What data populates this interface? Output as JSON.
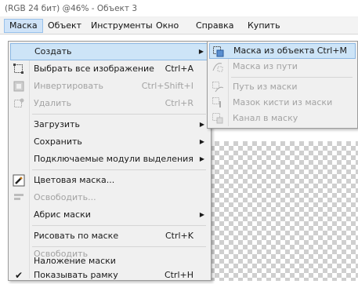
{
  "window": {
    "title": "(RGB 24 бит) @46% - Объект 3"
  },
  "menubar": {
    "items": [
      {
        "label": "Маска"
      },
      {
        "label": "Объект"
      },
      {
        "label": "Инструменты"
      },
      {
        "label": "Окно"
      },
      {
        "label": "Справка"
      },
      {
        "label": "Купить"
      }
    ]
  },
  "mask_menu": {
    "items": [
      {
        "label": "Создать",
        "shortcut": "",
        "submenu": true,
        "disabled": false,
        "icon": ""
      },
      {
        "label": "Выбрать все изображение",
        "shortcut": "Ctrl+A",
        "submenu": false,
        "disabled": false,
        "icon": "select-all-icon"
      },
      {
        "label": "Инвертировать",
        "shortcut": "Ctrl+Shift+I",
        "submenu": false,
        "disabled": true,
        "icon": "invert-mask-icon"
      },
      {
        "label": "Удалить",
        "shortcut": "Ctrl+R",
        "submenu": false,
        "disabled": true,
        "icon": "remove-mask-icon"
      },
      {
        "label": "Загрузить",
        "shortcut": "",
        "submenu": true,
        "disabled": false,
        "icon": ""
      },
      {
        "label": "Сохранить",
        "shortcut": "",
        "submenu": true,
        "disabled": false,
        "icon": ""
      },
      {
        "label": "Подключаемые модули выделения",
        "shortcut": "",
        "submenu": true,
        "disabled": false,
        "icon": ""
      },
      {
        "label": "Цветовая маска...",
        "shortcut": "",
        "submenu": false,
        "disabled": false,
        "icon": "color-mask-icon"
      },
      {
        "label": "Освободить...",
        "shortcut": "",
        "submenu": false,
        "disabled": true,
        "icon": "float-icon"
      },
      {
        "label": "Абрис маски",
        "shortcut": "",
        "submenu": true,
        "disabled": false,
        "icon": ""
      },
      {
        "label": "Рисовать по маске",
        "shortcut": "Ctrl+K",
        "submenu": false,
        "disabled": false,
        "icon": ""
      },
      {
        "label": "Освободить",
        "shortcut": "",
        "submenu": false,
        "disabled": true,
        "icon": ""
      },
      {
        "label": "Наложение маски",
        "shortcut": "",
        "submenu": false,
        "disabled": false,
        "icon": ""
      },
      {
        "label": "Показывать рамку",
        "shortcut": "Ctrl+H",
        "submenu": false,
        "disabled": false,
        "icon": "check-icon"
      }
    ]
  },
  "create_submenu": {
    "items": [
      {
        "label": "Маска из объекта",
        "shortcut": "Ctrl+M",
        "disabled": false,
        "icon": "mask-from-object-icon"
      },
      {
        "label": "Маска из пути",
        "shortcut": "",
        "disabled": true,
        "icon": "mask-from-path-icon"
      },
      {
        "label": "Путь из маски",
        "shortcut": "",
        "disabled": true,
        "icon": "path-from-mask-icon"
      },
      {
        "label": "Мазок кисти из маски",
        "shortcut": "",
        "disabled": true,
        "icon": "brush-stroke-icon"
      },
      {
        "label": "Канал в маску",
        "shortcut": "",
        "disabled": true,
        "icon": "channel-to-mask-icon"
      }
    ]
  }
}
